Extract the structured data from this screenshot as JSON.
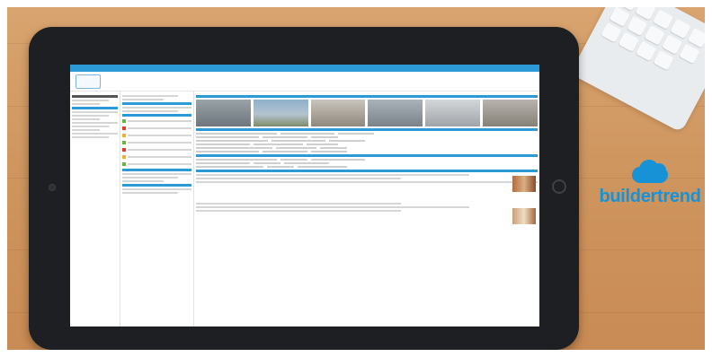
{
  "brand": {
    "name": "buildertrend",
    "icon": "cloud-icon",
    "color": "#1792d6"
  },
  "colors": {
    "wood": "#cf9660",
    "tablet_bezel": "#1d1f22",
    "app_accent": "#2b9ad6"
  }
}
